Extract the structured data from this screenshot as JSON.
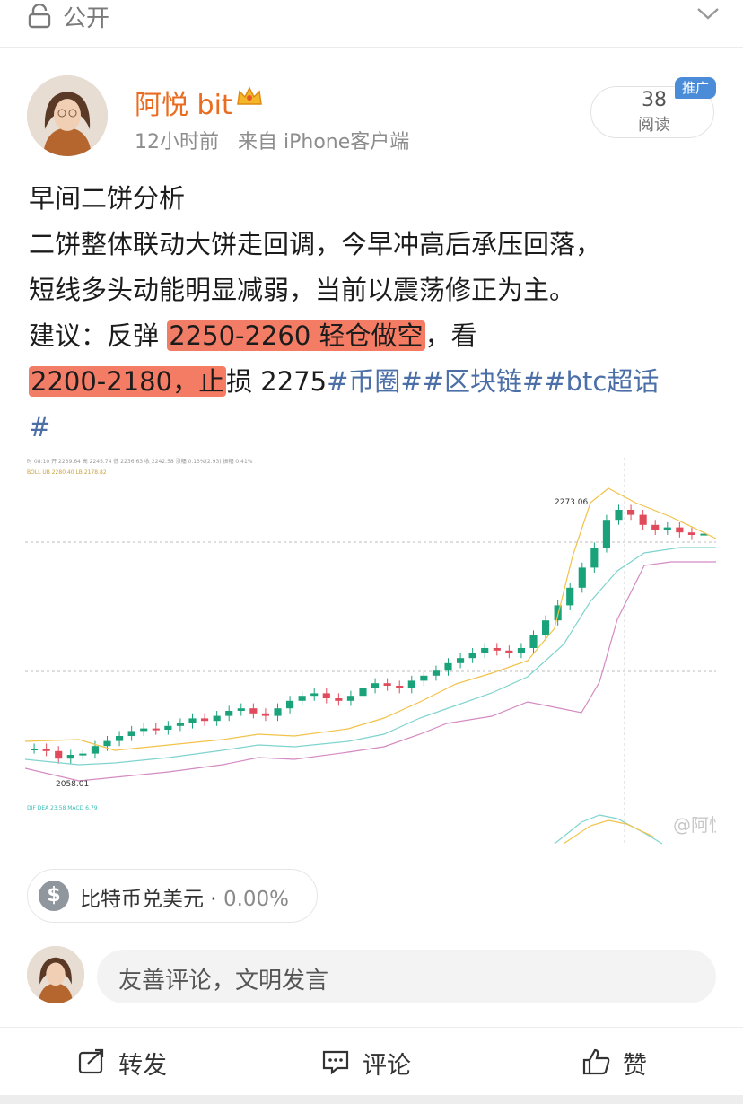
{
  "top_bar": {
    "visibility_label": "公开",
    "icon": "lock-icon"
  },
  "post": {
    "author": "阿悦 bit",
    "time": "12小时前",
    "source": "来自 iPhone客户端",
    "reads_count": "38",
    "reads_label": "阅读",
    "promo_badge": "推广",
    "title": "早间二饼分析",
    "line1": "二饼整体联动大饼走回调，今早冲高后承压回落，",
    "line2": "短线多头动能明显减弱，当前以震荡修正为主。",
    "line3_a": "建议：反弹 ",
    "line3_hl": "2250-2260 轻仓做空",
    "line3_b": "，看",
    "line4_hl": "2200-2180，止",
    "line4_b": "损 2275",
    "tag1": "#币圈#",
    "tag2": "#区块链#",
    "tag3": "#btc超话",
    "tag3_end": "#"
  },
  "chart": {
    "high_label": "2273.06",
    "low_label": "2058.01",
    "watermark": "@阿悦"
  },
  "chart_data": {
    "type": "line",
    "title": "",
    "close_series": [
      2080,
      2078,
      2072,
      2075,
      2076,
      2082,
      2086,
      2090,
      2094,
      2096,
      2095,
      2098,
      2100,
      2104,
      2102,
      2106,
      2110,
      2112,
      2108,
      2106,
      2112,
      2118,
      2122,
      2124,
      2120,
      2118,
      2122,
      2128,
      2132,
      2130,
      2128,
      2134,
      2138,
      2142,
      2148,
      2152,
      2156,
      2160,
      2158,
      2156,
      2160,
      2170,
      2182,
      2194,
      2208,
      2224,
      2240,
      2262,
      2270,
      2266,
      2258,
      2254,
      2256,
      2252,
      2250,
      2251
    ],
    "high_marker": 2273.06,
    "low_marker": 2058.01
  },
  "stock_card": {
    "name": "比特币兑美元",
    "change": "0.00%"
  },
  "comment": {
    "placeholder": "友善评论，文明发言"
  },
  "actions": {
    "repost": "转发",
    "comment": "评论",
    "like": "赞"
  }
}
